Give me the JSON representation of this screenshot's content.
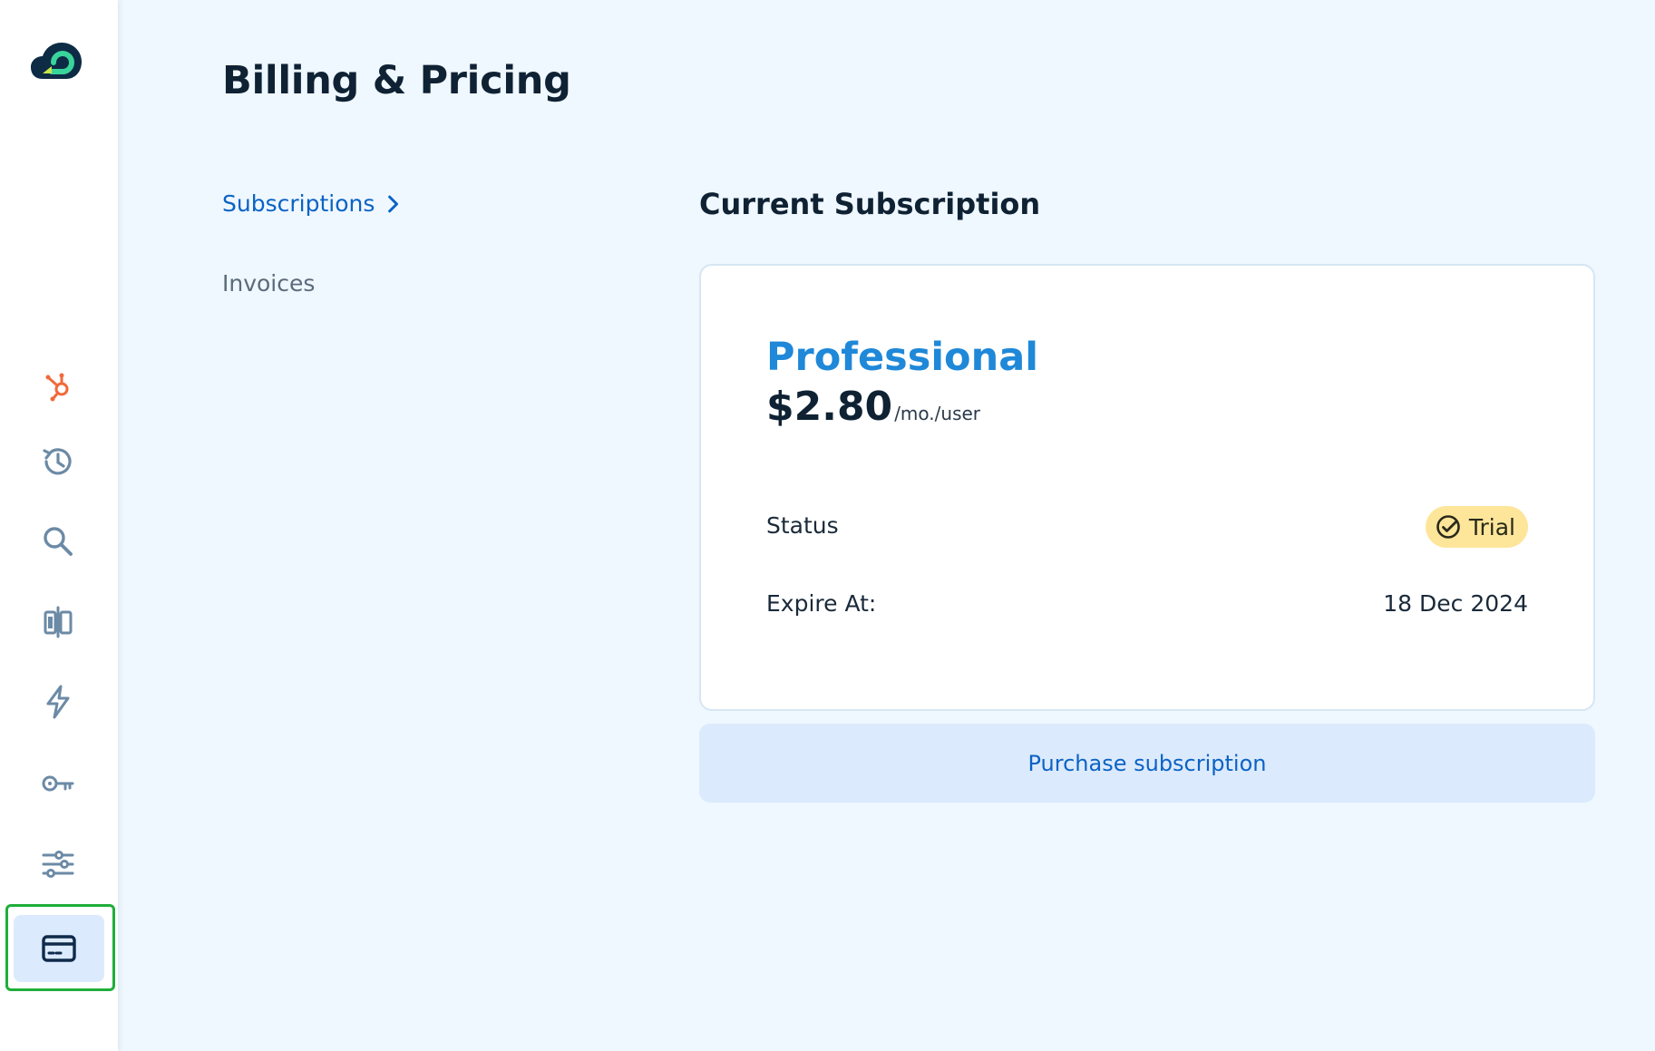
{
  "page": {
    "title": "Billing & Pricing"
  },
  "subnav": {
    "subscriptions_label": "Subscriptions",
    "invoices_label": "Invoices"
  },
  "sidebar": {
    "items": [
      {
        "icon": "hubspot-icon"
      },
      {
        "icon": "history-icon"
      },
      {
        "icon": "search-icon"
      },
      {
        "icon": "compare-icon"
      },
      {
        "icon": "lightning-icon"
      },
      {
        "icon": "key-icon"
      },
      {
        "icon": "settings-sliders-icon"
      },
      {
        "icon": "credit-card-icon",
        "active": true
      }
    ]
  },
  "subscription": {
    "section_title": "Current Subscription",
    "plan_name": "Professional",
    "price": "$2.80",
    "price_unit": "/mo./user",
    "status_label": "Status",
    "status_value": "Trial",
    "expire_label": "Expire At:",
    "expire_value": "18 Dec 2024",
    "purchase_label": "Purchase subscription"
  },
  "colors": {
    "accent": "#1f88d8",
    "link": "#0b63c4",
    "badge_bg": "#fde59a",
    "active_outline": "#1fae3a",
    "page_bg": "#eff7ff"
  }
}
